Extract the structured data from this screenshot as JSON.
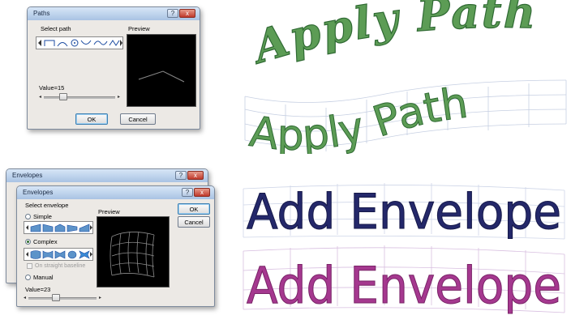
{
  "paths_dialog": {
    "title": "Paths",
    "help_label": "?",
    "close_label": "x",
    "select_path_label": "Select path",
    "preview_label": "Preview",
    "value_text": "Value=15",
    "value": 15,
    "ok_label": "OK",
    "cancel_label": "Cancel"
  },
  "envelopes_back": {
    "title": "Envelopes",
    "help_label": "?",
    "close_label": "x"
  },
  "envelopes_dialog": {
    "title": "Envelopes",
    "help_label": "?",
    "close_label": "x",
    "select_envelope_label": "Select envelope",
    "preview_label": "Preview",
    "simple_label": "Simple",
    "complex_label": "Complex",
    "on_straight_label": "On straight baseline",
    "manual_label": "Manual",
    "value_text": "Value=23",
    "value": 23,
    "ok_label": "OK",
    "cancel_label": "Cancel",
    "selected_option": "Complex"
  },
  "samples": {
    "apply_path_arc_text": "Apply Path",
    "apply_path_wave_text": "Apply Path",
    "add_envelope_blue_text": "Add Envelope",
    "add_envelope_purple_text": "Add Envelope"
  },
  "colors": {
    "green_thread": "#4f8f4a",
    "green_dark": "#2f6a33",
    "navy_thread": "#22265e",
    "purple_thread": "#a5388f",
    "grid_line": "#b9c7e0",
    "preview_bg": "#000000"
  }
}
